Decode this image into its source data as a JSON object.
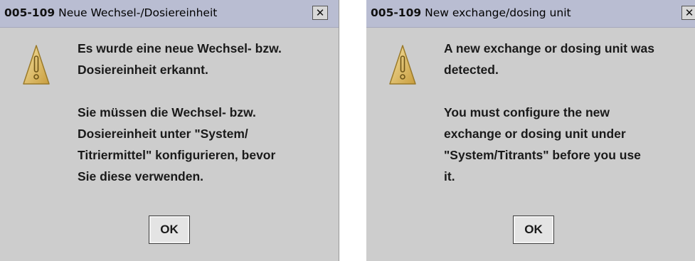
{
  "dialogs": [
    {
      "title_code": "005-109",
      "title_text": "Neue Wechsel-/Dosiereinheit",
      "close_symbol": "✕",
      "icon": "warning-triangle-icon",
      "message_paragraph_1": [
        "Es wurde eine neue Wechsel- bzw.",
        "Dosiereinheit erkannt."
      ],
      "message_paragraph_2": [
        "Sie müssen die Wechsel- bzw.",
        "Dosiereinheit unter \"System/",
        "Titriermittel\" konfigurieren, bevor",
        "Sie diese verwenden."
      ],
      "ok_label": "OK"
    },
    {
      "title_code": "005-109",
      "title_text": "New exchange/dosing unit",
      "close_symbol": "✕",
      "icon": "warning-triangle-icon",
      "message_paragraph_1": [
        "A new exchange or dosing unit was",
        "detected."
      ],
      "message_paragraph_2": [
        "You must configure the new",
        "exchange or dosing unit under",
        "\"System/Titrants\" before you use",
        "it."
      ],
      "ok_label": "OK"
    }
  ],
  "colors": {
    "dialog_bg": "#cdcdcd",
    "titlebar_bg": "#b9bdd2",
    "warning_fill": "#e2c56a",
    "warning_stroke": "#9a7a2a"
  }
}
